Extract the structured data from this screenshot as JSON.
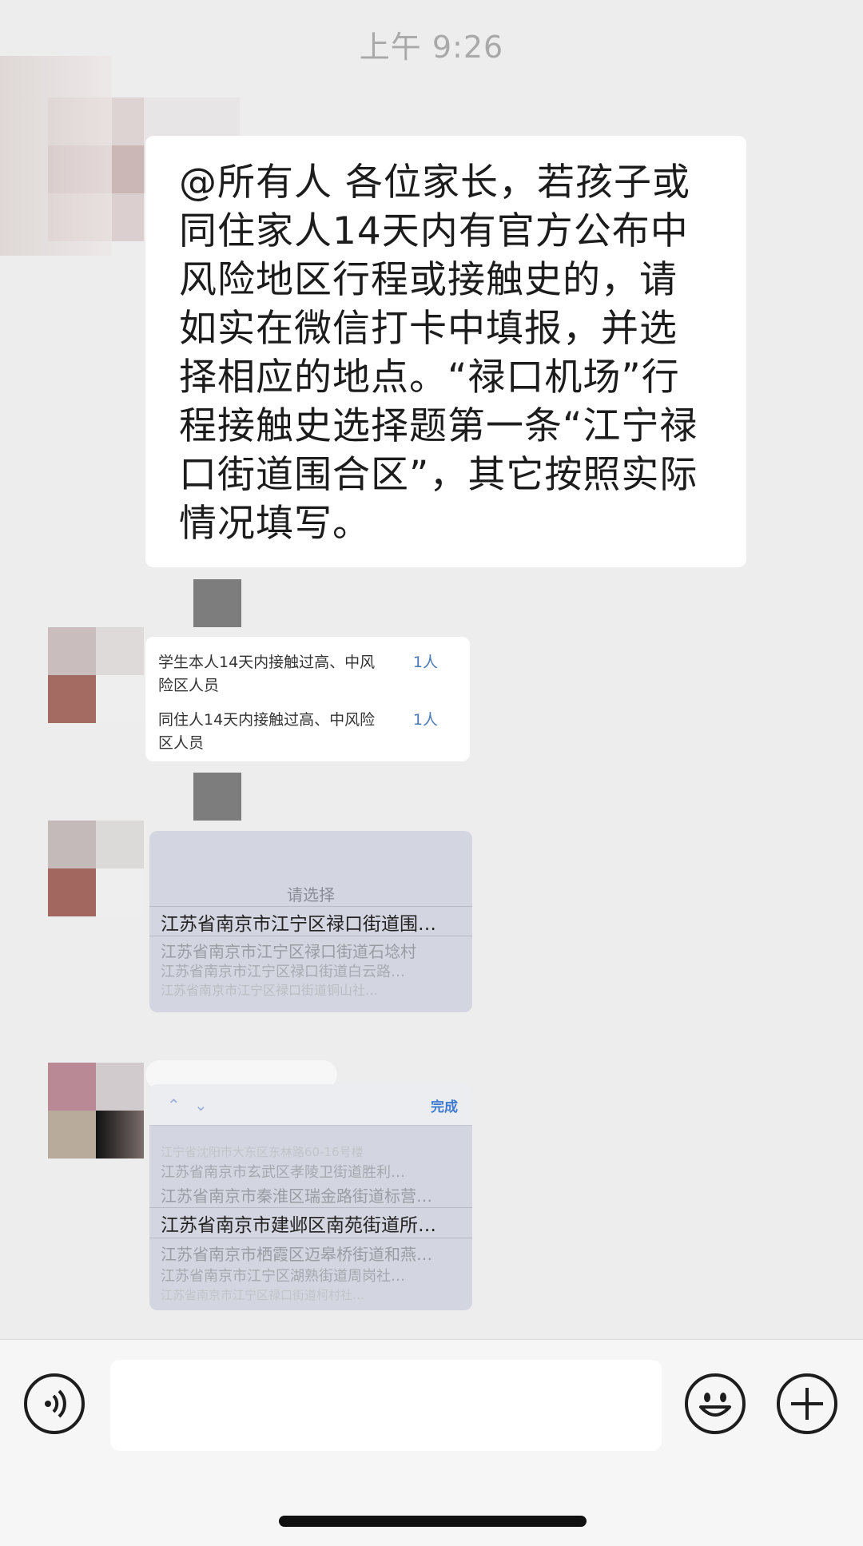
{
  "status": {
    "time": "上午 9:26"
  },
  "messages": {
    "announcement": "@所有人 各位家长，若孩子或同住家人14天内有官方公布中风险地区行程或接触史的，请如实在微信打卡中填报，并选择相应的地点。“禄口机场”行程接触史选择题第一条“江宁禄口街道围合区”，其它按照实际情况填写。",
    "risk_card": {
      "rows": [
        {
          "label": "学生本人14天内接触过高、中风险区人员",
          "count": "1人"
        },
        {
          "label": "同住人14天内接触过高、中风险区人员",
          "count": "1人"
        }
      ]
    },
    "picker_card_1": {
      "title": "请选择",
      "options": [
        "江苏省南京市江宁区禄口街道围…",
        "江苏省南京市江宁区禄口街道石埝村",
        "江苏省南京市江宁区禄口街道白云路…",
        "江苏省南京市江宁区禄口街道铜山社…"
      ]
    },
    "picker_card_2": {
      "done_label": "完成",
      "options": [
        "江宁省沈阳市大东区东林路60-16号楼",
        "江苏省南京市玄武区孝陵卫街道胜利…",
        "江苏省南京市秦淮区瑞金路街道标营…",
        "江苏省南京市建邺区南苑街道所…",
        "江苏省南京市栖霞区迈皋桥街道和燕…",
        "江苏省南京市江宁区湖熟街道周岗社…",
        "江苏省南京市江宁区禄口街道柯村社…"
      ]
    }
  },
  "input_bar": {
    "placeholder": ""
  },
  "icons": {
    "voice": "voice-icon",
    "emoji": "emoji-icon",
    "add": "plus-icon",
    "up": "chevron-up-icon",
    "down": "chevron-down-icon"
  },
  "colors": {
    "background": "#ededed",
    "bubble": "#ffffff",
    "picker": "#d3d6e0",
    "accent": "#3f7ad0"
  }
}
